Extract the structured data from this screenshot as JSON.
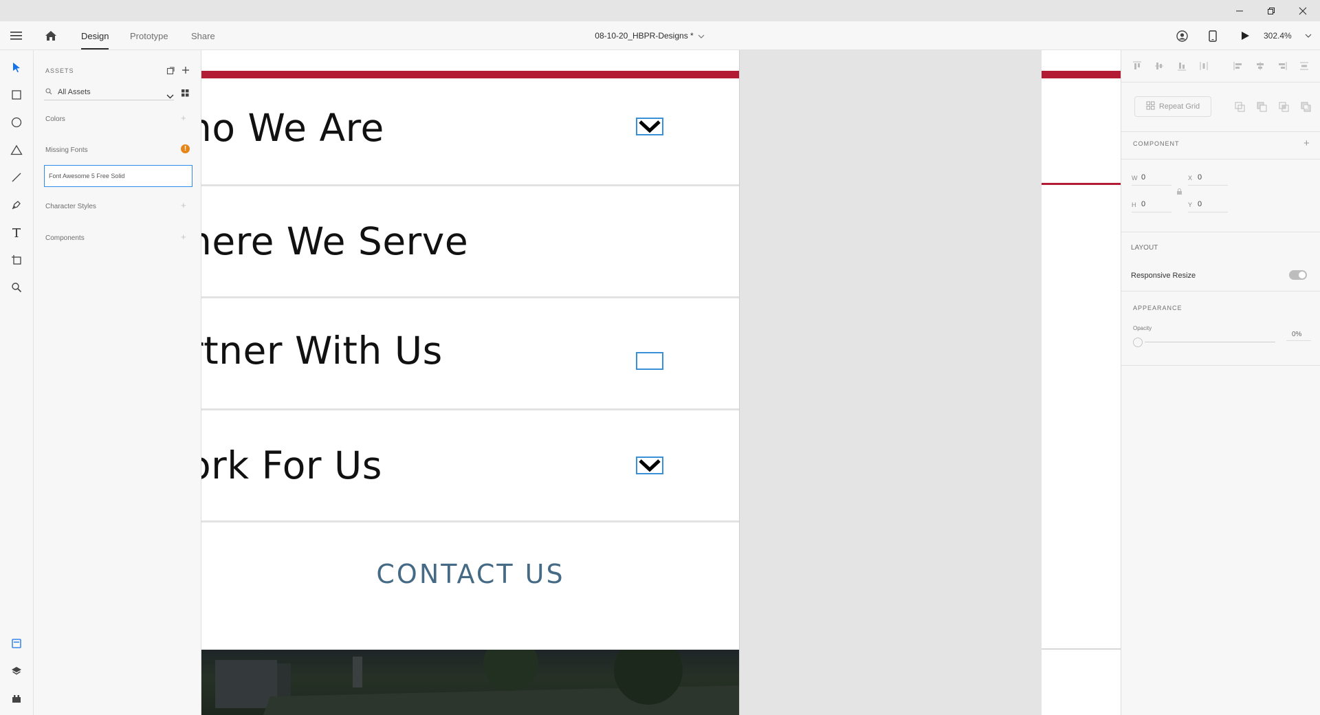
{
  "menubar": {
    "tabs": [
      {
        "label": "Design",
        "active": true
      },
      {
        "label": "Prototype",
        "active": false
      },
      {
        "label": "Share",
        "active": false
      }
    ],
    "document_title": "08-10-20_HBPR-Designs *",
    "zoom": "302.4%"
  },
  "assets": {
    "header": "ASSETS",
    "filter_label": "All Assets",
    "colors_label": "Colors",
    "missing_fonts_label": "Missing Fonts",
    "missing_font_name": "Font Awesome 5 Free Solid",
    "character_styles_label": "Character Styles",
    "components_label": "Components"
  },
  "artboard": {
    "sections": [
      {
        "title": "ho We Are",
        "chevron": true
      },
      {
        "title": "here We Serve",
        "chevron": false
      },
      {
        "title": "rtner With Us",
        "chevron": "empty"
      },
      {
        "title": "ork For Us",
        "chevron": true
      }
    ],
    "contact_label": "CONTACT US",
    "accent_color": "#b31b34",
    "contact_color": "#456a85"
  },
  "properties": {
    "repeat_grid_label": "Repeat Grid",
    "component_label": "COMPONENT",
    "w_label": "W",
    "w_value": "0",
    "h_label": "H",
    "h_value": "0",
    "x_label": "X",
    "x_value": "0",
    "y_label": "Y",
    "y_value": "0",
    "layout_label": "LAYOUT",
    "responsive_resize_label": "Responsive Resize",
    "appearance_label": "APPEARANCE",
    "opacity_label": "Opacity",
    "opacity_value": "0%"
  }
}
